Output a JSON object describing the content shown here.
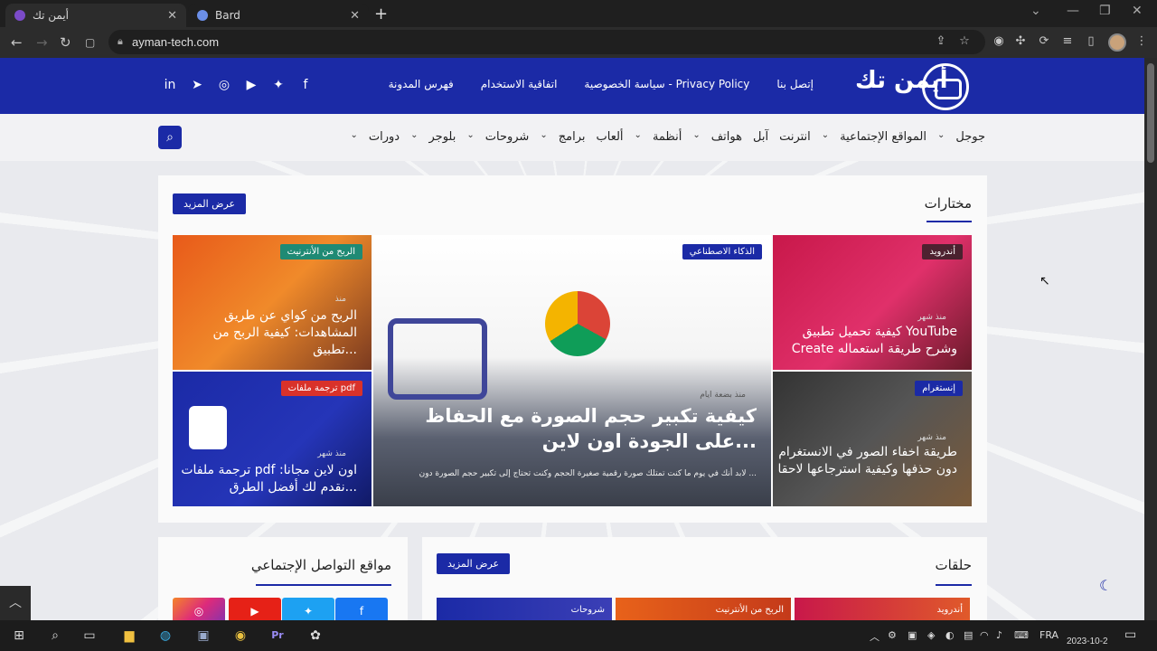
{
  "browser": {
    "tabs": [
      {
        "title": "أيمن تك",
        "active": true
      },
      {
        "title": "Bard",
        "active": false
      }
    ],
    "new_tab": "+",
    "url": "ayman-tech.com"
  },
  "site": {
    "logo_text": "أيمن تك",
    "top_links": [
      "إتصل بنا",
      "سياسة الخصوصية - Privacy Policy",
      "اتفاقية الاستخدام",
      "فهرس المدونة"
    ],
    "social_icons": [
      "facebook-icon",
      "twitter-icon",
      "youtube-icon",
      "instagram-icon",
      "telegram-icon",
      "linkedin-icon"
    ],
    "menu": [
      "جوجل",
      "المواقع الإجتماعية",
      "انترنت",
      "آبل",
      "هواتف",
      "أنظمة",
      "ألعاب",
      "برامج",
      "شروحات",
      "بلوجر",
      "دورات"
    ]
  },
  "featured": {
    "section_title": "مختارات",
    "more_label": "عرض المزيد",
    "cards": [
      {
        "tag": "أندرويد",
        "meta": "منذ شهر",
        "title": "كيفية تحميل تطبيق YouTube Create وشرح طريقة استعماله"
      },
      {
        "tag": "إنستغرام",
        "meta": "منذ شهر",
        "title": "طريقة اخفاء الصور في الانستغرام دون حذفها وكيفية استرجاعها لاحقا"
      },
      {
        "tag": "الذكاء الاصطناعي",
        "meta": "منذ بضعة ايام",
        "title": "كيفية تكبير حجم الصورة مع الحفاظ على الجودة اون لاين...",
        "excerpt": "لابد أنك في يوم ما كنت تمتلك صورة رقمية صغيرة الحجم وكنت تحتاج إلى تكبير حجم الصورة دون ..."
      },
      {
        "tag": "الربح من الأنترنيت",
        "meta": "منذ",
        "title": "الربح من كواي عن طريق المشاهدات: كيفية الربح من تطبيق..."
      },
      {
        "tag": "ترجمة ملفات pdf",
        "meta": "منذ شهر",
        "title": "ترجمة ملفات pdf اون لاين مجانا: نقدم لك أفضل الطرق..."
      }
    ]
  },
  "lower": {
    "social_title": "مواقع التواصل الإجتماعي",
    "episodes_title": "حلقات",
    "more_label": "عرض المزيد",
    "thumb_tags": [
      "أندرويد",
      "الربح من الأنترنيت",
      "شروحات"
    ]
  },
  "taskbar": {
    "lang": "FRA",
    "date": "2023-10-2"
  },
  "colors": {
    "brand": "#1b2aa6",
    "page_bg": "#e9eaee"
  }
}
